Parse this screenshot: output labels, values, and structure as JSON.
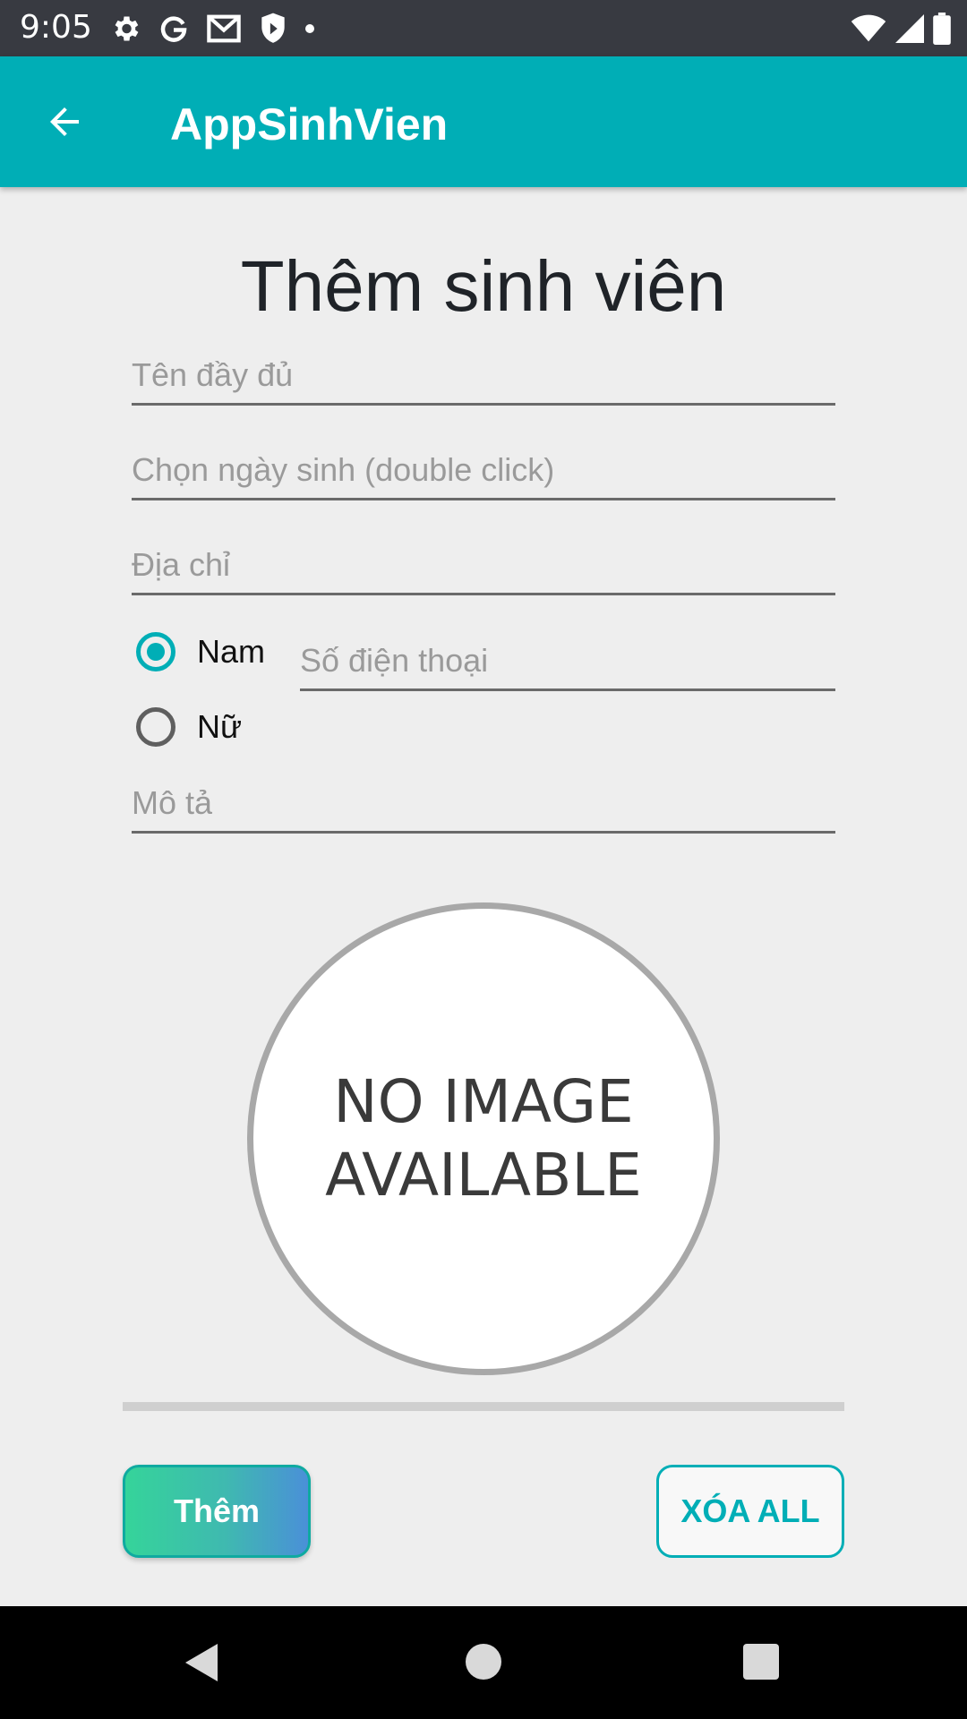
{
  "status_bar": {
    "time": "9:05",
    "left_icons": [
      "gear-icon",
      "google-icon",
      "gmail-icon",
      "shield-icon",
      "dot-icon"
    ],
    "right_icons": [
      "wifi-icon",
      "signal-icon",
      "battery-icon"
    ]
  },
  "app_bar": {
    "title": "AppSinhVien",
    "back_icon": "arrow-left-icon"
  },
  "form": {
    "heading": "Thêm sinh viên",
    "full_name_placeholder": "Tên đầy đủ",
    "birthday_placeholder": "Chọn ngày sinh (double click)",
    "address_placeholder": "Địa chỉ",
    "gender_options": [
      {
        "label": "Nam",
        "checked": true
      },
      {
        "label": "Nữ",
        "checked": false
      }
    ],
    "phone_placeholder": "Số điện thoại",
    "description_placeholder": "Mô tả"
  },
  "image_placeholder": {
    "line1": "NO IMAGE",
    "line2": "AVAILABLE"
  },
  "actions": {
    "add_label": "Thêm",
    "clear_label": "XÓA ALL"
  },
  "nav_bar": {
    "icons": [
      "back-triangle-icon",
      "home-circle-icon",
      "recent-square-icon"
    ]
  },
  "colors": {
    "primary": "#00aeb6",
    "status_bar": "#383a41",
    "background": "#eeeeee"
  }
}
